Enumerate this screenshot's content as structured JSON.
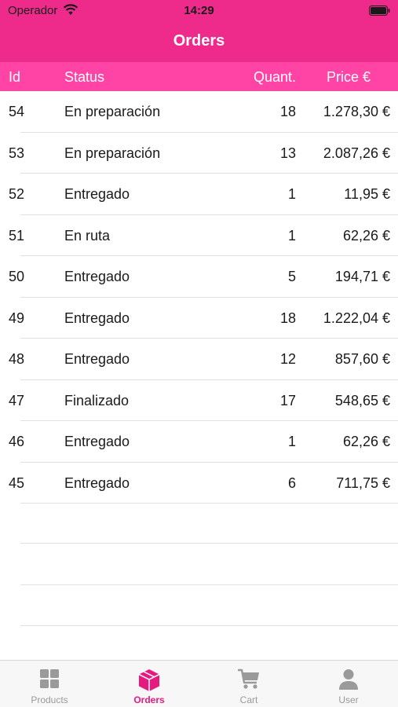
{
  "status_bar": {
    "carrier": "Operador",
    "time": "14:29"
  },
  "nav": {
    "title": "Orders"
  },
  "columns": {
    "id": "Id",
    "status": "Status",
    "quantity": "Quant.",
    "price": "Price €"
  },
  "orders": [
    {
      "id": "54",
      "status": "En preparación",
      "quantity": "18",
      "price": "1.278,30 €"
    },
    {
      "id": "53",
      "status": "En preparación",
      "quantity": "13",
      "price": "2.087,26 €"
    },
    {
      "id": "52",
      "status": "Entregado",
      "quantity": "1",
      "price": "11,95 €"
    },
    {
      "id": "51",
      "status": "En ruta",
      "quantity": "1",
      "price": "62,26 €"
    },
    {
      "id": "50",
      "status": "Entregado",
      "quantity": "5",
      "price": "194,71 €"
    },
    {
      "id": "49",
      "status": "Entregado",
      "quantity": "18",
      "price": "1.222,04 €"
    },
    {
      "id": "48",
      "status": "Entregado",
      "quantity": "12",
      "price": "857,60 €"
    },
    {
      "id": "47",
      "status": "Finalizado",
      "quantity": "17",
      "price": "548,65 €"
    },
    {
      "id": "46",
      "status": "Entregado",
      "quantity": "1",
      "price": "62,26 €"
    },
    {
      "id": "45",
      "status": "Entregado",
      "quantity": "6",
      "price": "711,75 €"
    }
  ],
  "tabs": [
    {
      "label": "Products",
      "icon": "grid-icon",
      "active": false
    },
    {
      "label": "Orders",
      "icon": "box-icon",
      "active": true
    },
    {
      "label": "Cart",
      "icon": "cart-icon",
      "active": false
    },
    {
      "label": "User",
      "icon": "user-icon",
      "active": false
    }
  ],
  "colors": {
    "accent": "#ee2b8b",
    "header": "#ff44a6",
    "active_tab": "#e6197f",
    "inactive_tab": "#9a9a9a"
  }
}
